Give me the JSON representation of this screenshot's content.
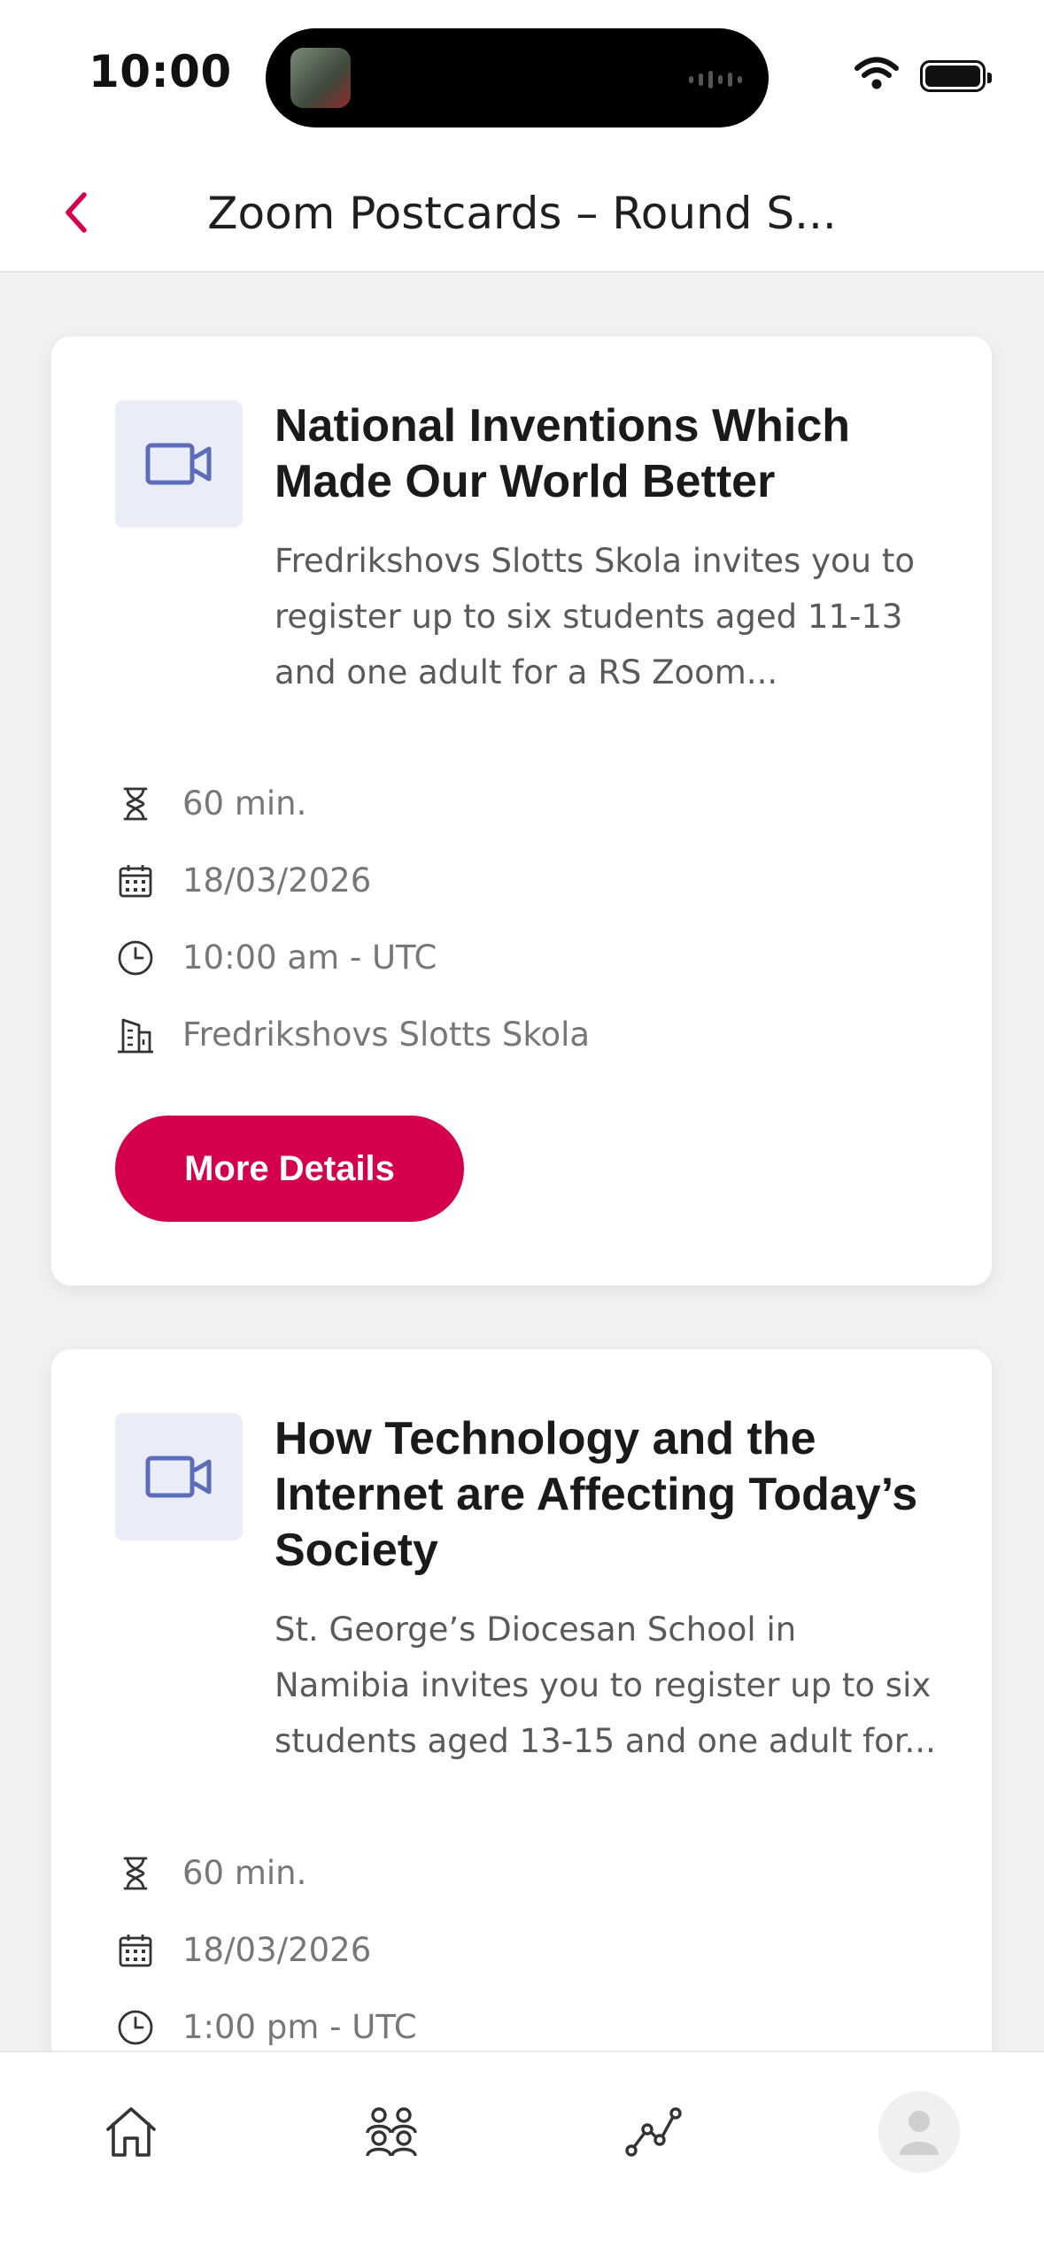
{
  "status_bar": {
    "time": "10:00",
    "icons": [
      "wifi-icon",
      "battery-icon"
    ]
  },
  "nav": {
    "back_icon": "chevron-left-icon",
    "title": "Zoom Postcards – Round S..."
  },
  "colors": {
    "accent": "#d4004c",
    "icon_tint": "#5b6db8",
    "icon_bg": "#eaedf7"
  },
  "cards": [
    {
      "type_icon": "video-camera-icon",
      "title": "National Inventions Which Made Our World Better",
      "description": "Fredrikshovs Slotts Skola invites you to register up to six students aged 11-13 and one adult for a RS Zoom...",
      "duration": "60 min.",
      "date": "18/03/2026",
      "time": "10:00 am - UTC",
      "location": "Fredrikshovs Slotts Skola",
      "button_label": "More Details"
    },
    {
      "type_icon": "video-camera-icon",
      "title": "How Technology and the Internet are Affecting Today’s Society",
      "description": "St. George’s Diocesan School in Namibia invites you to register up to six students aged 13-15 and one adult for...",
      "duration": "60 min.",
      "date": "18/03/2026",
      "time": "1:00 pm - UTC"
    }
  ],
  "tab_bar": {
    "items": [
      "home-icon",
      "groups-icon",
      "activity-icon",
      "profile-avatar"
    ]
  }
}
